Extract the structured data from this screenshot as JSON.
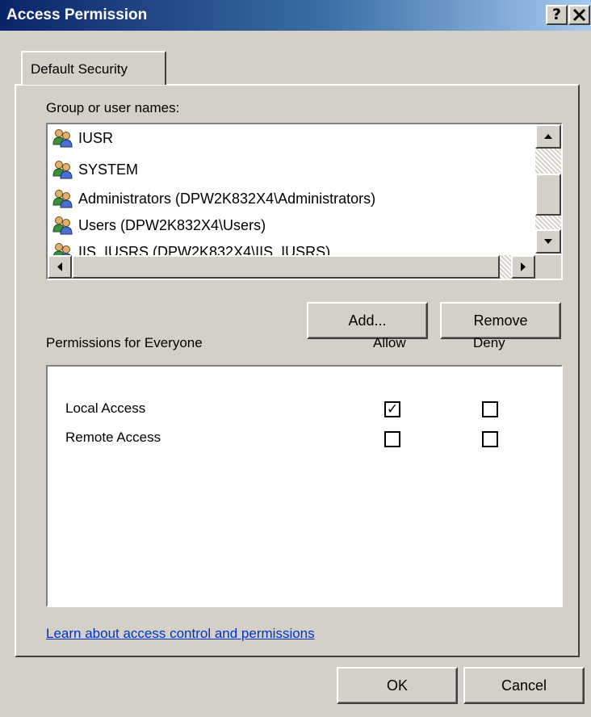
{
  "window": {
    "title": "Access Permission",
    "help_label": "?",
    "close_label": "✕"
  },
  "tabs": [
    {
      "label": "Default Security"
    }
  ],
  "group_section": {
    "label": "Group or user names:",
    "items": [
      {
        "name": "IUSR",
        "icon": "user-group-icon"
      },
      {
        "name": "SYSTEM",
        "icon": "user-group-icon"
      },
      {
        "name": "Administrators (DPW2K832X4\\Administrators)",
        "icon": "user-group-icon"
      },
      {
        "name": "Users (DPW2K832X4\\Users)",
        "icon": "user-group-icon"
      },
      {
        "name": "IIS_IUSRS (DPW2K832X4\\IIS_IUSRS)",
        "icon": "user-group-icon"
      }
    ]
  },
  "buttons": {
    "add": "Add...",
    "remove": "Remove",
    "ok": "OK",
    "cancel": "Cancel"
  },
  "permissions": {
    "header": "Permissions for Everyone",
    "allow_header": "Allow",
    "deny_header": "Deny",
    "rows": [
      {
        "label": "Local Access",
        "allow": true,
        "deny": false
      },
      {
        "label": "Remote Access",
        "allow": false,
        "deny": false
      }
    ]
  },
  "link_text": "Learn about access control and permissions",
  "colors": {
    "dialog_bg": "#d4d0c8",
    "titlebar_start": "#0a246a",
    "titlebar_end": "#a6caf0",
    "link": "#0033cc"
  }
}
